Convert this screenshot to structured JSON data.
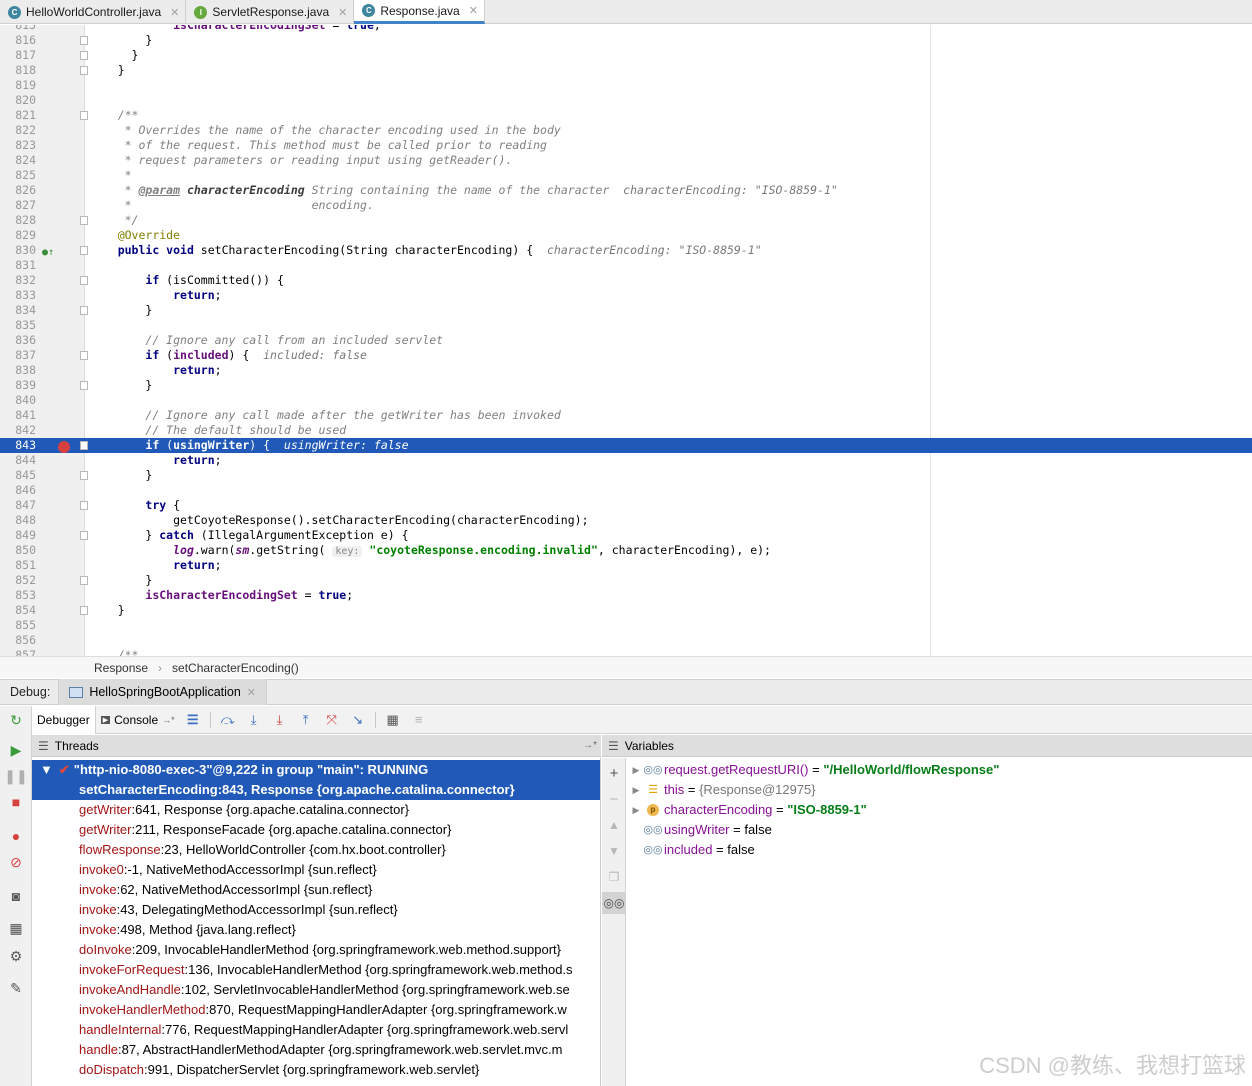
{
  "tabs": [
    {
      "label": "HelloWorldController.java",
      "icon": "C",
      "active": false
    },
    {
      "label": "ServletResponse.java",
      "icon": "I",
      "active": false
    },
    {
      "label": "Response.java",
      "icon": "C",
      "active": true
    }
  ],
  "editor": {
    "lines": [
      {
        "n": "815",
        "html": "        <span class='fld'>isCharacterEncodingSet</span> = <span class='kw'>true</span>;"
      },
      {
        "n": "816",
        "html": "    }"
      },
      {
        "n": "817",
        "html": "  }"
      },
      {
        "n": "818",
        "html": "}"
      },
      {
        "n": "819",
        "html": ""
      },
      {
        "n": "820",
        "html": ""
      },
      {
        "n": "821",
        "html": "<span class='cm'>/**</span>"
      },
      {
        "n": "822",
        "html": "<span class='cm'> * Overrides the name of the character encoding used in the body</span>"
      },
      {
        "n": "823",
        "html": "<span class='cm'> * of the request. This method must be called prior to reading</span>"
      },
      {
        "n": "824",
        "html": "<span class='cm'> * request parameters or reading input using getReader().</span>"
      },
      {
        "n": "825",
        "html": "<span class='cm'> *</span>"
      },
      {
        "n": "826",
        "html": "<span class='cm'> * </span><span class='jdtag'>@param</span> <span class='jdname'>characterEncoding</span><span class='cm'> String containing the name of the character</span>  <span class='hint'>characterEncoding: \"ISO-8859-1\"</span>"
      },
      {
        "n": "827",
        "html": "<span class='cm'> *                          encoding.</span>"
      },
      {
        "n": "828",
        "html": "<span class='cm'> */</span>"
      },
      {
        "n": "829",
        "html": "<span class='an'>@Override</span>"
      },
      {
        "n": "830",
        "html": "<span class='kw'>public void</span> setCharacterEncoding(String characterEncoding) {  <span class='hint'>characterEncoding: \"ISO-8859-1\"</span>"
      },
      {
        "n": "831",
        "html": ""
      },
      {
        "n": "832",
        "html": "    <span class='kw'>if</span> (isCommitted()) {"
      },
      {
        "n": "833",
        "html": "        <span class='kw'>return</span>;"
      },
      {
        "n": "834",
        "html": "    }"
      },
      {
        "n": "835",
        "html": ""
      },
      {
        "n": "836",
        "html": "    <span class='cm'>// Ignore any call from an included servlet</span>"
      },
      {
        "n": "837",
        "html": "    <span class='kw'>if</span> (<span class='fld'>included</span>) {  <span class='hint'>included: false</span>"
      },
      {
        "n": "838",
        "html": "        <span class='kw'>return</span>;"
      },
      {
        "n": "839",
        "html": "    }"
      },
      {
        "n": "840",
        "html": ""
      },
      {
        "n": "841",
        "html": "    <span class='cm'>// Ignore any call made after the getWriter has been invoked</span>"
      },
      {
        "n": "842",
        "html": "    <span class='cm'>// The default should be used</span>"
      },
      {
        "n": "843",
        "html": "    <b>if</b> (<b>usingWriter</b>) {  <span class='ital'>usingWriter: false</span>",
        "highlight": true
      },
      {
        "n": "844",
        "html": "        <span class='kw'>return</span>;"
      },
      {
        "n": "845",
        "html": "    }"
      },
      {
        "n": "846",
        "html": ""
      },
      {
        "n": "847",
        "html": "    <span class='kw'>try</span> {"
      },
      {
        "n": "848",
        "html": "        getCoyoteResponse().setCharacterEncoding(characterEncoding);"
      },
      {
        "n": "849",
        "html": "    } <span class='kw'>catch</span> (IllegalArgumentException e) {"
      },
      {
        "n": "850",
        "html": "        <span class='fld ital'>log</span>.warn(<span class='fld ital'>sm</span>.getString( <span class='hintbox'>key:</span> <span class='str'>\"coyoteResponse.encoding.invalid\"</span>, characterEncoding), e);"
      },
      {
        "n": "851",
        "html": "        <span class='kw'>return</span>;"
      },
      {
        "n": "852",
        "html": "    }"
      },
      {
        "n": "853",
        "html": "    <span class='fld'>isCharacterEncodingSet</span> = <span class='kw'>true</span>;"
      },
      {
        "n": "854",
        "html": "}"
      },
      {
        "n": "855",
        "html": ""
      },
      {
        "n": "856",
        "html": ""
      },
      {
        "n": "857",
        "html": "<span class='cm'>/**</span>"
      }
    ]
  },
  "breadcrumb": {
    "class": "Response",
    "sep": "›",
    "method": "setCharacterEncoding()"
  },
  "debug": {
    "label": "Debug:",
    "config": "HelloSpringBootApplication",
    "debugger_tab": "Debugger",
    "console_tab": "Console"
  },
  "threads": {
    "title": "Threads",
    "thread": "\"http-nio-8080-exec-3\"@9,222 in group \"main\": RUNNING",
    "frames": [
      {
        "m": "setCharacterEncoding",
        "rest": ":843, Response {org.apache.catalina.connector}",
        "sel": true
      },
      {
        "m": "getWriter",
        "rest": ":641, Response {org.apache.catalina.connector}"
      },
      {
        "m": "getWriter",
        "rest": ":211, ResponseFacade {org.apache.catalina.connector}"
      },
      {
        "m": "flowResponse",
        "rest": ":23, HelloWorldController {com.hx.boot.controller}"
      },
      {
        "m": "invoke0",
        "rest": ":-1, NativeMethodAccessorImpl {sun.reflect}"
      },
      {
        "m": "invoke",
        "rest": ":62, NativeMethodAccessorImpl {sun.reflect}"
      },
      {
        "m": "invoke",
        "rest": ":43, DelegatingMethodAccessorImpl {sun.reflect}"
      },
      {
        "m": "invoke",
        "rest": ":498, Method {java.lang.reflect}"
      },
      {
        "m": "doInvoke",
        "rest": ":209, InvocableHandlerMethod {org.springframework.web.method.support}"
      },
      {
        "m": "invokeForRequest",
        "rest": ":136, InvocableHandlerMethod {org.springframework.web.method.s"
      },
      {
        "m": "invokeAndHandle",
        "rest": ":102, ServletInvocableHandlerMethod {org.springframework.web.se"
      },
      {
        "m": "invokeHandlerMethod",
        "rest": ":870, RequestMappingHandlerAdapter {org.springframework.w"
      },
      {
        "m": "handleInternal",
        "rest": ":776, RequestMappingHandlerAdapter {org.springframework.web.servl"
      },
      {
        "m": "handle",
        "rest": ":87, AbstractHandlerMethodAdapter {org.springframework.web.servlet.mvc.m"
      },
      {
        "m": "doDispatch",
        "rest": ":991, DispatcherServlet {org.springframework.web.servlet}"
      }
    ]
  },
  "variables": {
    "title": "Variables",
    "items": [
      {
        "icon": "glasses",
        "name": "request.getRequestURI()",
        "eq": " = ",
        "value": "\"/HelloWorld/flowResponse\"",
        "type": "str",
        "expand": true
      },
      {
        "icon": "lines",
        "name": "this",
        "eq": " = ",
        "value": "{Response@12975}",
        "type": "ref",
        "expand": true
      },
      {
        "icon": "p",
        "name": "characterEncoding",
        "eq": " = ",
        "value": "\"ISO-8859-1\"",
        "type": "str",
        "expand": true
      },
      {
        "icon": "glasses",
        "name": "usingWriter",
        "eq": " = ",
        "value": "false",
        "type": "plain",
        "expand": false
      },
      {
        "icon": "glasses",
        "name": "included",
        "eq": " = ",
        "value": "false",
        "type": "plain",
        "expand": false
      }
    ]
  },
  "watermark": "CSDN @教练、我想打篮球"
}
